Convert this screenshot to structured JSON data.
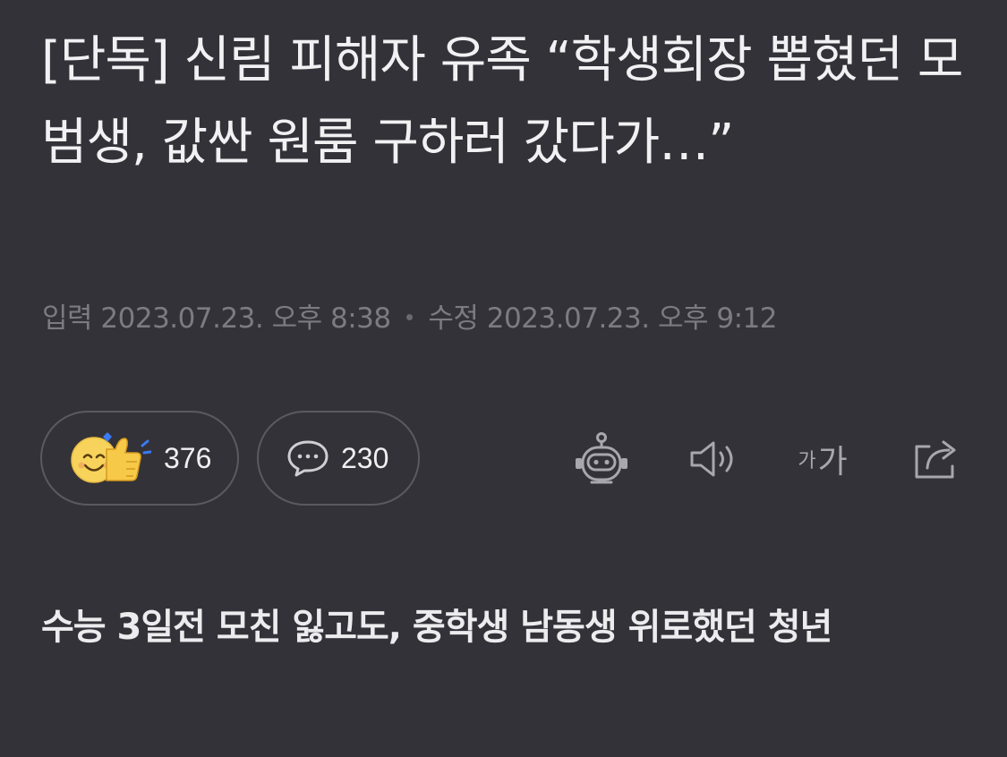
{
  "article": {
    "title": "[단독] 신림 피해자 유족 “학생회장 뽑혔던 모범생, 값싼 원룸 구하러 갔다가…”",
    "meta": {
      "input_label": "입력",
      "input_time": "2023.07.23. 오후 8:38",
      "edit_label": "수정",
      "edit_time": "2023.07.23. 오후 9:12"
    },
    "subheading": "수능 3일전 모친 잃고도, 중학생 남동생 위로했던 청년"
  },
  "actions": {
    "like_count": "376",
    "comment_count": "230",
    "font_small": "가",
    "font_large": "가"
  },
  "icons": {
    "like": "smiley-thumbs-up-icon",
    "comment": "speech-bubble-icon",
    "ai": "robot-icon",
    "speak": "speaker-icon",
    "font": "font-size-icon",
    "share": "share-icon"
  },
  "colors": {
    "background": "#333238",
    "text": "#f1f1f3",
    "meta_text": "#7c7b82",
    "pill_border": "#5b5a60",
    "icon": "#a8a7ad",
    "emoji_yellow": "#f7d35c",
    "emoji_blue": "#3b7bf2"
  }
}
